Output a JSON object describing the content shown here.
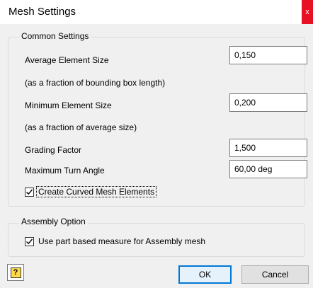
{
  "window": {
    "title": "Mesh Settings",
    "close_glyph": "x"
  },
  "common": {
    "group_label": "Common Settings",
    "avg_label": "Average Element Size",
    "avg_value": "0,150",
    "avg_hint": "(as a fraction of bounding box length)",
    "min_label": "Minimum Element Size",
    "min_value": "0,200",
    "min_hint": "(as a fraction of average size)",
    "grading_label": "Grading Factor",
    "grading_value": "1,500",
    "turn_label": "Maximum Turn Angle",
    "turn_value": "60,00 deg",
    "curved_label": "Create Curved Mesh Elements",
    "curved_checked": true
  },
  "assembly": {
    "group_label": "Assembly Option",
    "part_based_label": "Use part based measure for Assembly mesh",
    "part_based_checked": true
  },
  "footer": {
    "help_glyph": "?",
    "ok_label": "OK",
    "cancel_label": "Cancel"
  },
  "colors": {
    "close": "#e81123",
    "accent": "#0078d7"
  },
  "icons": {
    "close": "close-icon",
    "help": "help-icon",
    "check": "checkmark-icon"
  }
}
